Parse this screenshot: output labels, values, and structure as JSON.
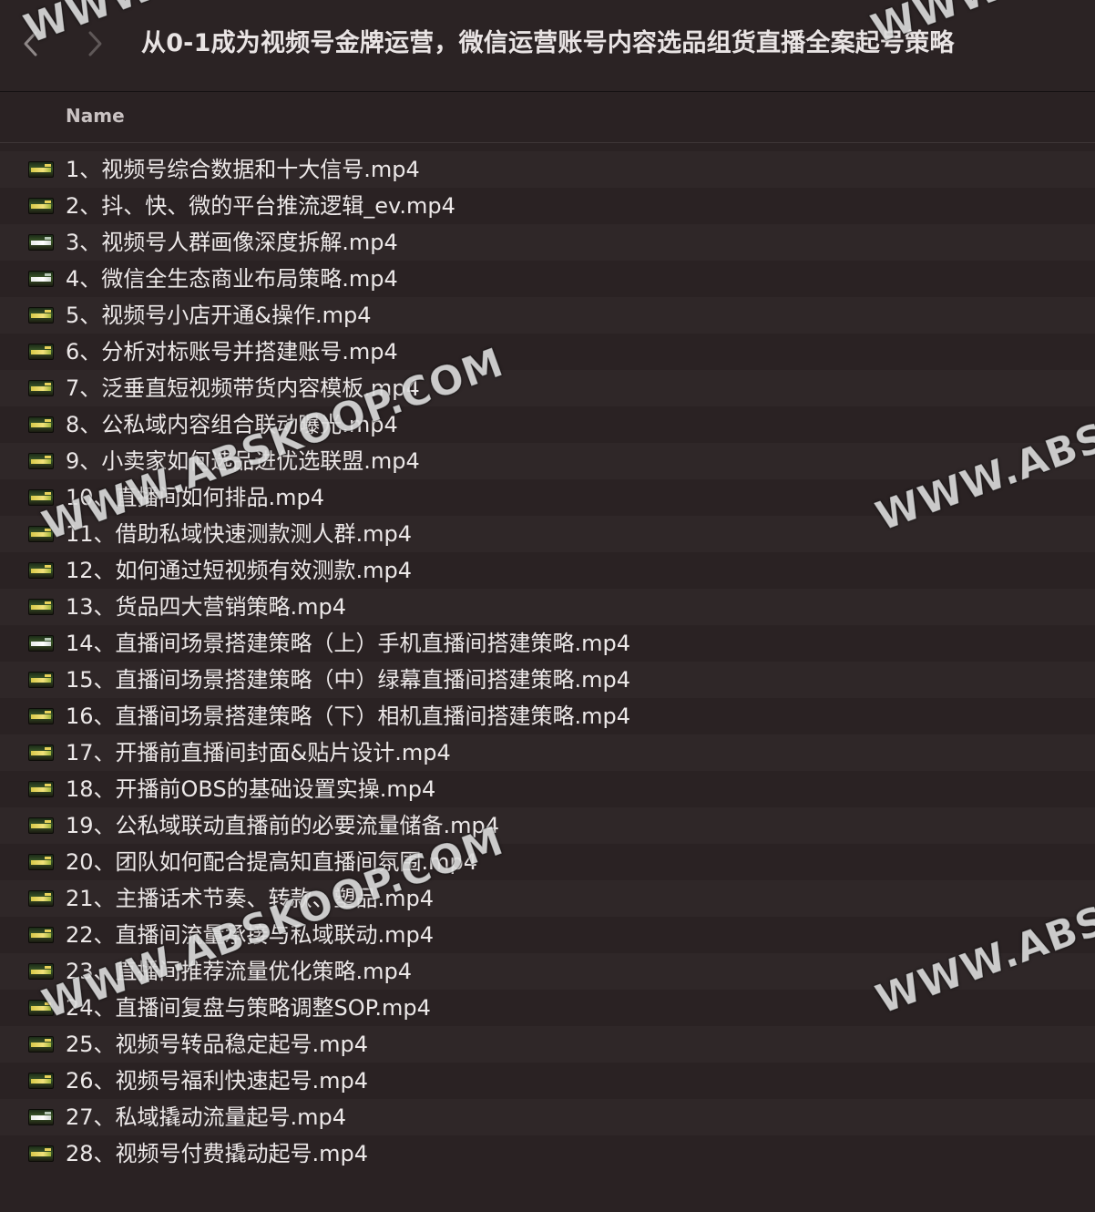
{
  "window": {
    "title": "从0-1成为视频号金牌运营，微信运营账号内容选品组货直播全案起号策略"
  },
  "navigation": {
    "back_icon": "chevron-left-icon",
    "forward_icon": "chevron-right-icon"
  },
  "list_header": {
    "name_column": "Name"
  },
  "files": [
    {
      "name": "1、视频号综合数据和十大信号.mp4",
      "icon": "video-file-icon"
    },
    {
      "name": "2、抖、快、微的平台推流逻辑_ev.mp4",
      "icon": "video-file-icon"
    },
    {
      "name": "3、视频号人群画像深度拆解.mp4",
      "icon": "video-file-icon"
    },
    {
      "name": "4、微信全生态商业布局策略.mp4",
      "icon": "video-file-icon"
    },
    {
      "name": "5、视频号小店开通&操作.mp4",
      "icon": "video-file-icon"
    },
    {
      "name": "6、分析对标账号并搭建账号.mp4",
      "icon": "video-file-icon"
    },
    {
      "name": "7、泛垂直短视频带货内容模板.mp4",
      "icon": "video-file-icon"
    },
    {
      "name": "8、公私域内容组合联动曝光.mp4",
      "icon": "video-file-icon"
    },
    {
      "name": "9、小卖家如何选品进优选联盟.mp4",
      "icon": "video-file-icon"
    },
    {
      "name": "10、直播间如何排品.mp4",
      "icon": "video-file-icon"
    },
    {
      "name": "11、借助私域快速测款测人群.mp4",
      "icon": "video-file-icon"
    },
    {
      "name": "12、如何通过短视频有效测款.mp4",
      "icon": "video-file-icon"
    },
    {
      "name": "13、货品四大营销策略.mp4",
      "icon": "video-file-icon"
    },
    {
      "name": "14、直播间场景搭建策略（上）手机直播间搭建策略.mp4",
      "icon": "video-file-icon"
    },
    {
      "name": "15、直播间场景搭建策略（中）绿幕直播间搭建策略.mp4",
      "icon": "video-file-icon"
    },
    {
      "name": "16、直播间场景搭建策略（下）相机直播间搭建策略.mp4",
      "icon": "video-file-icon"
    },
    {
      "name": "17、开播前直播间封面&贴片设计.mp4",
      "icon": "video-file-icon"
    },
    {
      "name": "18、开播前OBS的基础设置实操.mp4",
      "icon": "video-file-icon"
    },
    {
      "name": "19、公私域联动直播前的必要流量储备.mp4",
      "icon": "video-file-icon"
    },
    {
      "name": "20、团队如何配合提高知直播间氛围.mp4",
      "icon": "video-file-icon"
    },
    {
      "name": "21、主播话术节奏、转款、塑品.mp4",
      "icon": "video-file-icon"
    },
    {
      "name": "22、直播间流量承接与私域联动.mp4",
      "icon": "video-file-icon"
    },
    {
      "name": "23、直播间推荐流量优化策略.mp4",
      "icon": "video-file-icon"
    },
    {
      "name": "24、直播间复盘与策略调整SOP.mp4",
      "icon": "video-file-icon"
    },
    {
      "name": "25、视频号转品稳定起号.mp4",
      "icon": "video-file-icon"
    },
    {
      "name": "26、视频号福利快速起号.mp4",
      "icon": "video-file-icon"
    },
    {
      "name": "27、私域撬动流量起号.mp4",
      "icon": "video-file-icon"
    },
    {
      "name": "28、视频号付费撬动起号.mp4",
      "icon": "video-file-icon"
    }
  ],
  "watermarks": [
    "WWW.ABSKOOP.COM",
    "WWW.ABSKO",
    "WWW.ABSKOOP.COM",
    "WWW.ABSKO",
    "WWW",
    "WWW"
  ]
}
